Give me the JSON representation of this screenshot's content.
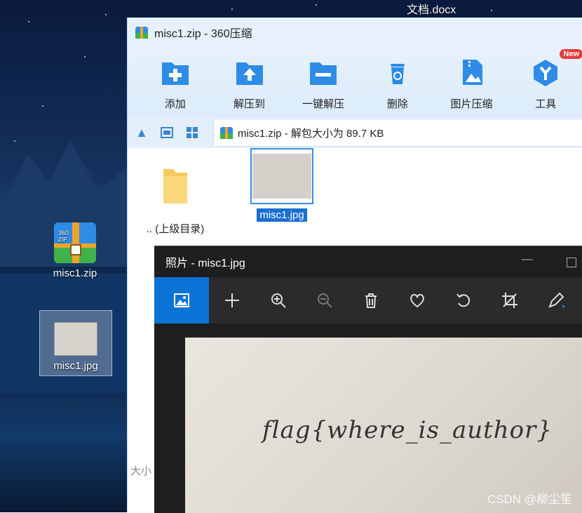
{
  "desktop": {
    "top_file_label": "文档.docx",
    "icons": [
      {
        "label": "misc1.zip"
      },
      {
        "label": "misc1.jpg"
      }
    ]
  },
  "zip_window": {
    "title": "misc1.zip - 360压缩",
    "toolbar": [
      {
        "label": "添加",
        "icon": "add-folder-icon"
      },
      {
        "label": "解压到",
        "icon": "extract-to-icon"
      },
      {
        "label": "一键解压",
        "icon": "one-click-extract-icon"
      },
      {
        "label": "删除",
        "icon": "delete-icon"
      },
      {
        "label": "图片压缩",
        "icon": "image-compress-icon"
      },
      {
        "label": "工具",
        "icon": "tools-icon",
        "badge": "New"
      }
    ],
    "path_text": "misc1.zip - 解包大小为 89.7 KB",
    "files": [
      {
        "label": ".. (上级目录)",
        "icon": "folder-icon"
      },
      {
        "label": "misc1.jpg",
        "icon": "image-thumbnail",
        "selected": true
      }
    ],
    "status_text": "大小"
  },
  "photo_window": {
    "title": "照片 - misc1.jpg",
    "toolbar": [
      "image-icon",
      "plus-icon",
      "zoom-in-icon",
      "zoom-out-icon",
      "trash-icon",
      "heart-icon",
      "rotate-icon",
      "crop-icon",
      "edit-icon"
    ],
    "image_text": "flag{where_is_author}"
  },
  "watermark": "CSDN @柳尘笙",
  "colors": {
    "accent": "#0a74d6",
    "zip_blue": "#2e8be6",
    "selection": "#1a6fd1"
  }
}
